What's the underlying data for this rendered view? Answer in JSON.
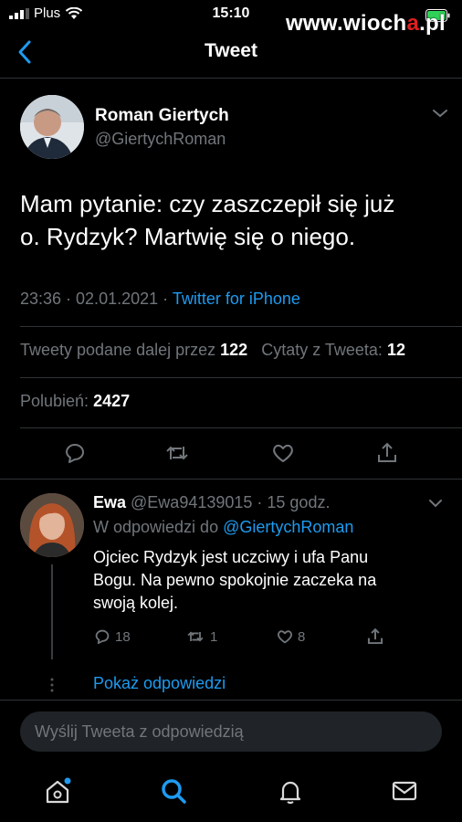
{
  "status_bar": {
    "carrier": "Plus",
    "time": "15:10",
    "watermark_prefix": "www.wioch",
    "watermark_letter": "a",
    "watermark_suffix": ".pl"
  },
  "nav": {
    "title": "Tweet"
  },
  "tweet": {
    "author_name": "Roman Giertych",
    "author_handle": "@GiertychRoman",
    "text_line1": "Mam pytanie: czy zaszczepił się już",
    "text_line2": "o. Rydzyk? Martwię się o niego.",
    "timestamp": "23:36 · 02.01.2021 · ",
    "source": "Twitter for iPhone",
    "retweets_label": "Tweety podane dalej przez ",
    "retweets_count": "122",
    "quotes_label": "Cytaty z Tweeta: ",
    "quotes_count": "12",
    "likes_label": "Polubień: ",
    "likes_count": "2427"
  },
  "reply": {
    "author_name": "Ewa",
    "author_handle_time": " @Ewa94139015 · 15 godz.",
    "replying_to_label": "W odpowiedzi do ",
    "replying_to_handle": "@GiertychRoman",
    "text_line1": "Ojciec Rydzyk jest uczciwy i ufa Panu",
    "text_line2": "Bogu. Na pewno spokojnie zaczeka na",
    "text_line3": "swoją kolej.",
    "reply_count": "18",
    "retweet_count": "1",
    "like_count": "8",
    "show_replies": "Pokaż odpowiedzi"
  },
  "composer": {
    "placeholder": "Wyślij Tweeta z odpowiedzią"
  },
  "icons": {
    "back": "chevron-left-icon",
    "reply": "comment-icon",
    "retweet": "retweet-icon",
    "like": "heart-icon",
    "share": "share-icon",
    "tabs": [
      "home-icon",
      "search-icon",
      "bell-icon",
      "mail-icon"
    ]
  },
  "colors": {
    "background": "#000000",
    "accent": "#1d9bf0",
    "secondary_text": "#71767b",
    "divider": "#2f3336",
    "battery": "#30d158"
  }
}
